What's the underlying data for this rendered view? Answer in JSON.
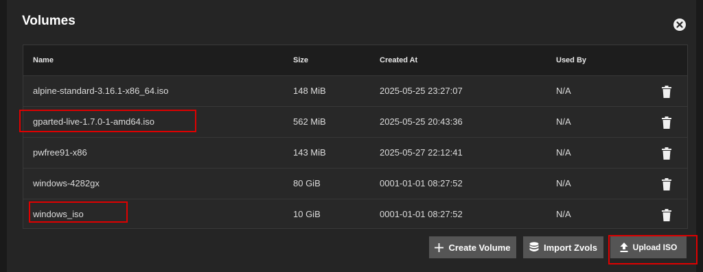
{
  "dialog": {
    "title": "Volumes"
  },
  "table": {
    "columns": [
      "Name",
      "Size",
      "Created At",
      "Used By"
    ],
    "rows": [
      {
        "name": "alpine-standard-3.16.1-x86_64.iso",
        "size": "148 MiB",
        "created": "2025-05-25 23:27:07",
        "used_by": "N/A"
      },
      {
        "name": "gparted-live-1.7.0-1-amd64.iso",
        "size": "562 MiB",
        "created": "2025-05-25 20:43:36",
        "used_by": "N/A"
      },
      {
        "name": "pwfree91-x86",
        "size": "143 MiB",
        "created": "2025-05-27 22:12:41",
        "used_by": "N/A"
      },
      {
        "name": "windows-4282gx",
        "size": "80 GiB",
        "created": "0001-01-01 08:27:52",
        "used_by": "N/A"
      },
      {
        "name": "windows_iso",
        "size": "10 GiB",
        "created": "0001-01-01 08:27:52",
        "used_by": "N/A"
      }
    ]
  },
  "actions": {
    "create_volume": "Create Volume",
    "import_zvols": "Import Zvols",
    "upload_iso": "Upload ISO"
  },
  "icons": {
    "close": "close-icon",
    "delete": "trash-icon",
    "add": "plus-icon",
    "import": "database-icon",
    "upload": "upload-icon"
  },
  "colors": {
    "highlight": "#e00000"
  }
}
